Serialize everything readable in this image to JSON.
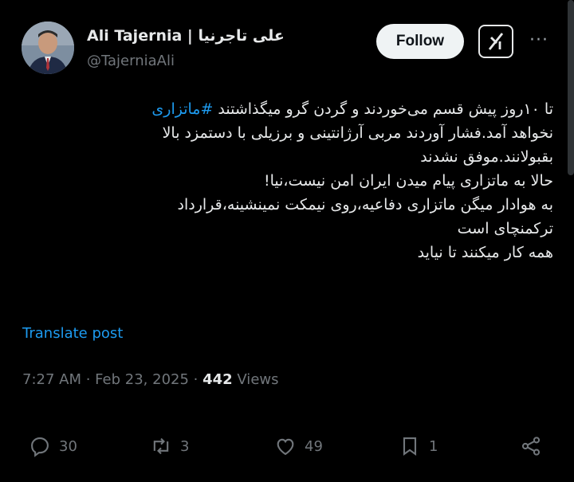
{
  "author": {
    "name": "Ali Tajernia | علی تاجرنیا",
    "handle": "@TajerniaAli"
  },
  "header": {
    "follow_label": "Follow"
  },
  "tweet": {
    "line1_prefix": "تا ۱۰روز پیش قسم می‌خوردند و گردن گرو میگذاشتند ",
    "line1_hashtag": "#ماتزاری",
    "line2": "نخواهد آمد.فشار آوردند مربی آرژانتینی و برزیلی با دستمزد بالا",
    "line3": "بقبولانند.موفق نشدند",
    "line4": "حالا به ماتزاری پیام میدن ایران امن نیست،نیا!",
    "line5": "به هوادار میگن ماتزاری دفاعیه،روی نیمکت نمینشینه،قرارداد",
    "line6": "ترکمنچای است",
    "line7": "همه کار میکنند تا نیاید"
  },
  "translate_label": "Translate post",
  "meta": {
    "time": "7:27 AM",
    "sep1": " · ",
    "date": "Feb 23, 2025",
    "sep2": " · ",
    "views_count": "442",
    "views_label": " Views"
  },
  "actions": {
    "replies": "30",
    "reposts": "3",
    "likes": "49",
    "bookmarks": "1"
  },
  "icons": [
    "reply-icon",
    "repost-icon",
    "like-icon",
    "bookmark-icon",
    "share-icon",
    "grok-icon",
    "more-icon"
  ],
  "colors": {
    "accent": "#1d9bf0",
    "text": "#e7e9ea",
    "muted": "#71767b",
    "background": "#000000"
  }
}
